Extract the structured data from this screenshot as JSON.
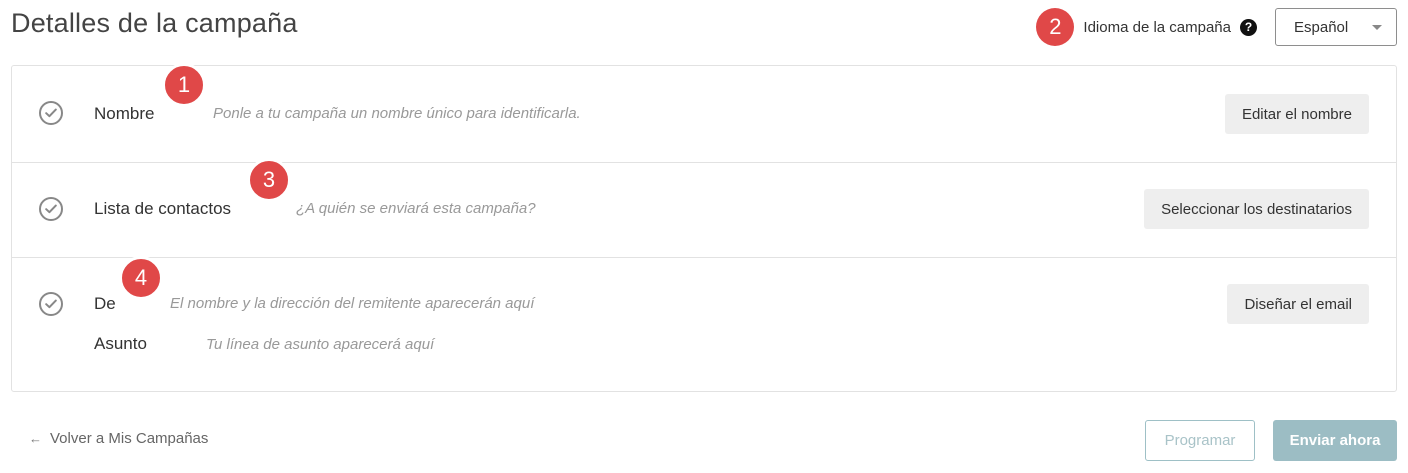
{
  "header": {
    "title": "Detalles de la campaña",
    "language_label": "Idioma de la campaña",
    "help_glyph": "?",
    "language_value": "Español"
  },
  "badges": [
    "1",
    "2",
    "3",
    "4"
  ],
  "rows": {
    "name": {
      "label": "Nombre",
      "hint": "Ponle a tu campaña un nombre único para identificarla.",
      "button": "Editar el nombre"
    },
    "contacts": {
      "label": "Lista de contactos",
      "hint": "¿A quién se enviará esta campaña?",
      "button": "Seleccionar los destinatarios"
    },
    "from": {
      "label": "De",
      "hint": "El nombre y la dirección del remitente aparecerán aquí",
      "button": "Diseñar el email"
    },
    "subject": {
      "label": "Asunto",
      "hint": "Tu línea de asunto aparecerá aquí"
    }
  },
  "footer": {
    "back_arrow": "←",
    "back_label": "Volver a Mis Campañas",
    "schedule_label": "Programar",
    "send_label": "Enviar ahora"
  },
  "colors": {
    "badge": "#e04848",
    "primary_disabled": "#9cbdc4",
    "secondary_button": "#eeeeee"
  },
  "icons": [
    "check-circle-icon",
    "help-icon",
    "chevron-down-icon",
    "arrow-left-icon"
  ]
}
